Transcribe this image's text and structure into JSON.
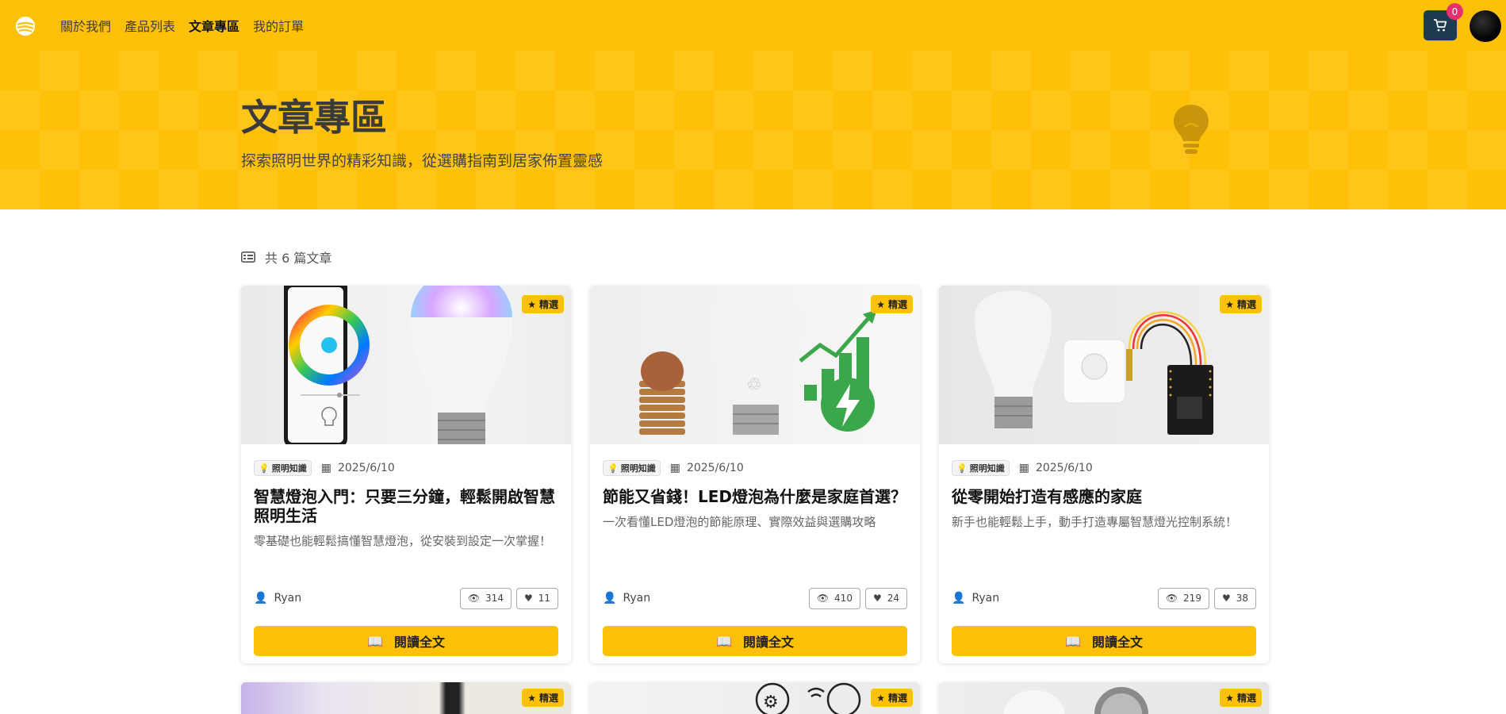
{
  "nav": {
    "links": [
      "關於我們",
      "產品列表",
      "文章專區",
      "我的訂單"
    ],
    "active_index": 2,
    "cart_count": "0"
  },
  "hero": {
    "title": "文章專區",
    "subtitle": "探索照明世界的精彩知識，從選購指南到居家佈置靈感"
  },
  "article_count_label": "共 6 篇文章",
  "featured_label": "精選",
  "read_label": "閱讀全文",
  "articles": [
    {
      "category": "照明知識",
      "date": "2025/6/10",
      "title": "智慧燈泡入門：只要三分鐘，輕鬆開啟智慧照明生活",
      "excerpt": "零基礎也能輕鬆搞懂智慧燈泡，從安裝到設定一次掌握！",
      "author": "Ryan",
      "views": "314",
      "likes": "11"
    },
    {
      "category": "照明知識",
      "date": "2025/6/10",
      "title": "節能又省錢！LED燈泡為什麼是家庭首選？",
      "excerpt": "一次看懂LED燈泡的節能原理、實際效益與選購攻略",
      "author": "Ryan",
      "views": "410",
      "likes": "24"
    },
    {
      "category": "照明知識",
      "date": "2025/6/10",
      "title": "從零開始打造有感應的家庭",
      "excerpt": "新手也能輕鬆上手，動手打造專屬智慧燈光控制系統！",
      "author": "Ryan",
      "views": "219",
      "likes": "38"
    }
  ],
  "colors": {
    "primary": "#ffc107",
    "dark": "#1e3a4f",
    "badge": "#e8306f"
  }
}
